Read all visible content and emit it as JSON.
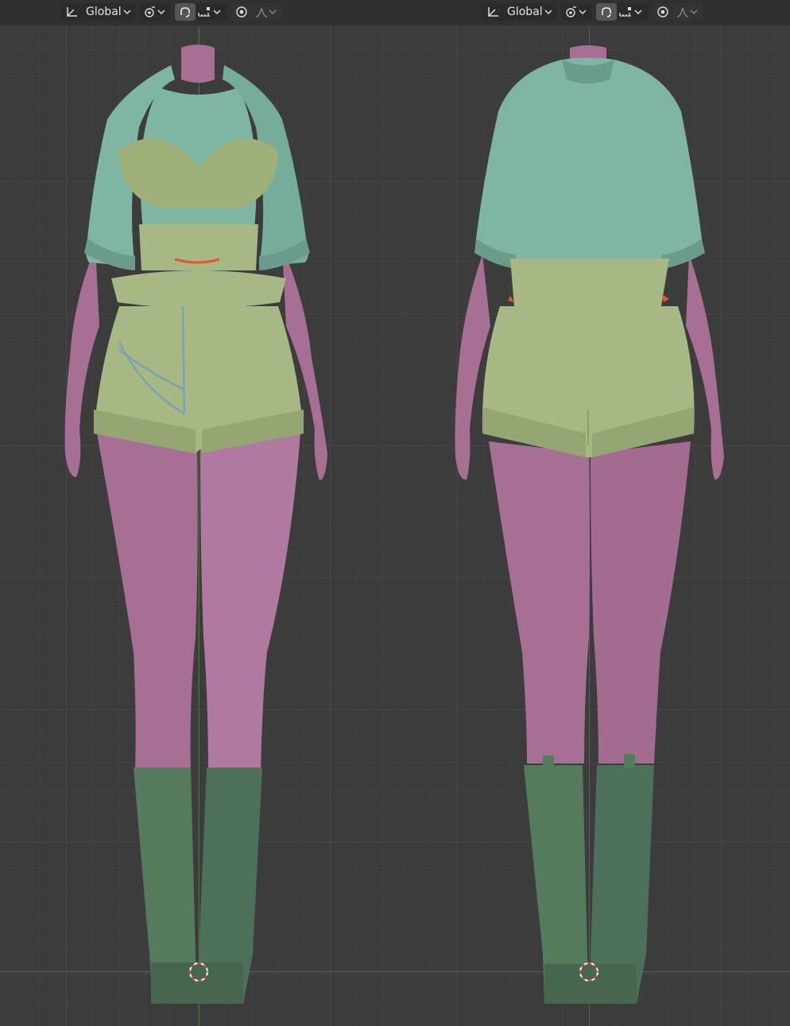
{
  "viewports": [
    {
      "id": "front",
      "header": {
        "orientation_label": "Global",
        "orientation_icon": "transform-orientation-icon",
        "pivot_icon": "pivot-point-icon",
        "snap_icon": "snap-icon",
        "snap_target_icon": "snap-increment-icon",
        "proportional_icon": "proportional-editing-icon",
        "falloff_icon": "falloff-curve-icon"
      }
    },
    {
      "id": "back",
      "header": {
        "orientation_label": "Global",
        "orientation_icon": "transform-orientation-icon",
        "pivot_icon": "pivot-point-icon",
        "snap_icon": "snap-icon",
        "snap_target_icon": "snap-increment-icon",
        "proportional_icon": "proportional-editing-icon",
        "falloff_icon": "falloff-curve-icon"
      }
    }
  ],
  "colors": {
    "skin": "#a86f94",
    "skin_shade": "#8a5a79",
    "jacket": "#7fb5a3",
    "jacket_shade": "#6a9b8b",
    "bra": "#9fb07a",
    "shorts": "#a8b884",
    "shorts_shade": "#8e9f6d",
    "boots": "#557a5c",
    "boots_shade": "#46664d",
    "accent_red": "#e5533a",
    "chain": "#7aa3b3",
    "axis_x": "#b03a3a",
    "grid": "#474747",
    "header_bg": "#303030"
  }
}
